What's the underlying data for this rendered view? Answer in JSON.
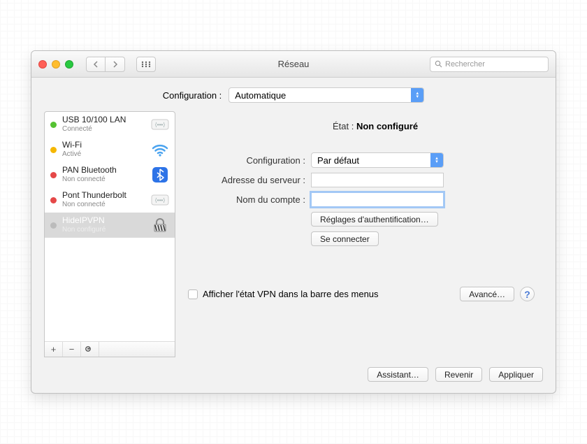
{
  "window": {
    "title": "Réseau"
  },
  "search": {
    "placeholder": "Rechercher"
  },
  "topConfig": {
    "label": "Configuration :",
    "value": "Automatique"
  },
  "services": [
    {
      "name": "USB 10/100 LAN",
      "sub": "Connecté",
      "status": "green",
      "icon": "ethernet"
    },
    {
      "name": "Wi-Fi",
      "sub": "Activé",
      "status": "yellow",
      "icon": "wifi"
    },
    {
      "name": "PAN Bluetooth",
      "sub": "Non connecté",
      "status": "red",
      "icon": "bluetooth"
    },
    {
      "name": "Pont Thunderbolt",
      "sub": "Non connecté",
      "status": "red",
      "icon": "ethernet"
    },
    {
      "name": "HideIPVPN",
      "sub": "Non configuré",
      "status": "grey",
      "icon": "lock",
      "selected": true
    }
  ],
  "detail": {
    "stateLabel": "État :",
    "stateValue": "Non configuré",
    "configLabel": "Configuration :",
    "configValue": "Par défaut",
    "serverLabel": "Adresse du serveur :",
    "serverValue": "",
    "accountLabel": "Nom du compte :",
    "accountValue": "",
    "authButton": "Réglages d'authentification…",
    "connectButton": "Se connecter",
    "vpnCheckbox": "Afficher l'état VPN dans la barre des menus",
    "advancedButton": "Avancé…"
  },
  "footer": {
    "assistant": "Assistant…",
    "revert": "Revenir",
    "apply": "Appliquer"
  },
  "toolbar": {
    "plus": "+",
    "minus": "−",
    "gear": "✻▾"
  }
}
